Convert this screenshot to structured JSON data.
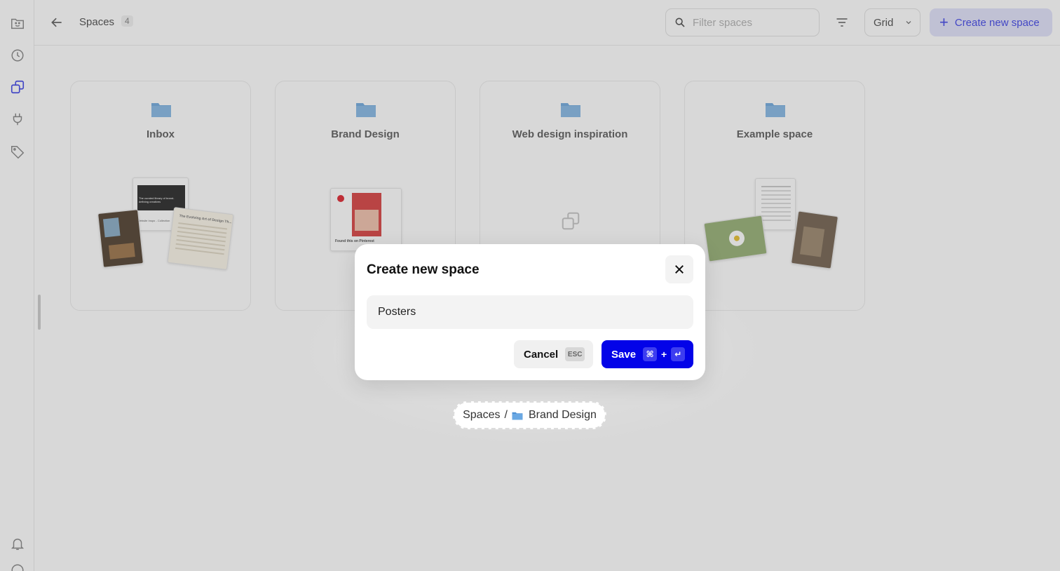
{
  "sidebar": {
    "icons": [
      "inbox-smile-icon",
      "history-icon",
      "spaces-icon",
      "plug-icon",
      "tag-icon",
      "bell-icon",
      "help-icon"
    ]
  },
  "header": {
    "title": "Spaces",
    "count": "4",
    "search_placeholder": "Filter spaces",
    "view_label": "Grid",
    "create_label": "Create new space"
  },
  "spaces": [
    {
      "title": "Inbox"
    },
    {
      "title": "Brand Design",
      "preview_caption": "Found this on Pinterest"
    },
    {
      "title": "Web design inspiration"
    },
    {
      "title": "Example space"
    }
  ],
  "inbox_previews": {
    "note_title": "The Evolving Art of Design Th...",
    "card_text": "The curated library of brand-defining creatives",
    "card_footer": "Website Inspo - Collection"
  },
  "modal": {
    "title": "Create new space",
    "input_value": "Posters",
    "cancel_label": "Cancel",
    "cancel_shortcut": "ESC",
    "save_label": "Save",
    "save_shortcut_mod": "⌘",
    "save_shortcut_plus": "+",
    "save_shortcut_key": "↵"
  },
  "breadcrumb": {
    "root": "Spaces",
    "separator": "/",
    "current": "Brand Design"
  },
  "colors": {
    "accent": "#0303e8",
    "create_bg": "#e2e3fb",
    "create_text": "#4a4fe8",
    "folder": "#78aee0"
  }
}
